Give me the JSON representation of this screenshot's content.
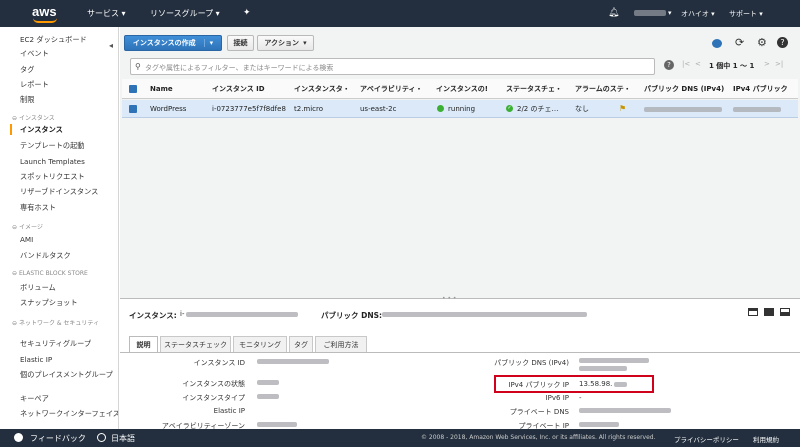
{
  "topnav": {
    "logo": "aws",
    "services": "サービス",
    "resource_groups": "リソースグループ",
    "region": "オハイオ",
    "support": "サポート"
  },
  "sidebar": {
    "dashboard": "EC2 ダッシュボード",
    "events": "イベント",
    "tags": "タグ",
    "reports": "レポート",
    "limits": "制限",
    "sec_instances": "インスタンス",
    "instances": "インスタンス",
    "launch_config": "テンプレートの起動",
    "launch_templates": "Launch Templates",
    "spot_requests": "スポットリクエスト",
    "reserved": "リザーブドインスタンス",
    "dedicated": "専有ホスト",
    "sec_images": "イメージ",
    "ami": "AMI",
    "bundle": "バンドルタスク",
    "sec_ebs": "ELASTIC BLOCK STORE",
    "volumes": "ボリューム",
    "snapshots": "スナップショット",
    "sec_network": "ネットワーク & セキュリティ",
    "security_groups": "セキュリティグループ",
    "elastic_ip": "Elastic IP",
    "placement": "個のプレイスメントグループ",
    "key_pairs": "キーペア",
    "network_if": "ネットワークインターフェイス"
  },
  "toolbar": {
    "create": "インスタンスの作成",
    "connect": "接続",
    "actions": "アクション"
  },
  "search": {
    "placeholder": "タグや属性によるフィルター、またはキーワードによる検索",
    "pagination": "1 個中 1 ～ 1"
  },
  "table": {
    "headers": [
      "Name",
      "インスタンス ID",
      "インスタンスタ・",
      "アベイラビリティ・",
      "インスタンスの!",
      "ステータスチェ・",
      "アラームのステ・",
      "パブリック DNS (IPv4)",
      "IPv4 パブリック"
    ],
    "row": {
      "name": "WordPress",
      "id": "i-0723777e5f7f8dfe8",
      "type": "t2.micro",
      "az": "us-east-2c",
      "state": "running",
      "status": "2/2 のチェ…",
      "alarm": "なし"
    }
  },
  "detail": {
    "instance_label": "インスタンス:",
    "instance_val": "i-",
    "public_dns_label": "パブリック DNS:",
    "tabs": [
      "説明",
      "ステータスチェック",
      "モニタリング",
      "タグ",
      "ご利用方法"
    ],
    "left_labels": [
      "インスタンス ID",
      "インスタンスの状態",
      "インスタンスタイプ",
      "Elastic IP",
      "アベイラビリティーゾーン"
    ],
    "right_labels": [
      "パブリック DNS (IPv4)",
      "IPv4 パブリック IP",
      "IPv6 IP",
      "プライベート DNS",
      "プライベート IP"
    ],
    "ipv4_val": "13.58.98.",
    "ipv6_val": "-",
    "highlight_color": "#d0021b"
  },
  "footer": {
    "feedback": "フィードバック",
    "lang": "日本語",
    "copyright": "© 2008 - 2018, Amazon Web Services, Inc. or its affiliates. All rights reserved.",
    "privacy": "プライバシーポリシー",
    "terms": "利用規約"
  }
}
